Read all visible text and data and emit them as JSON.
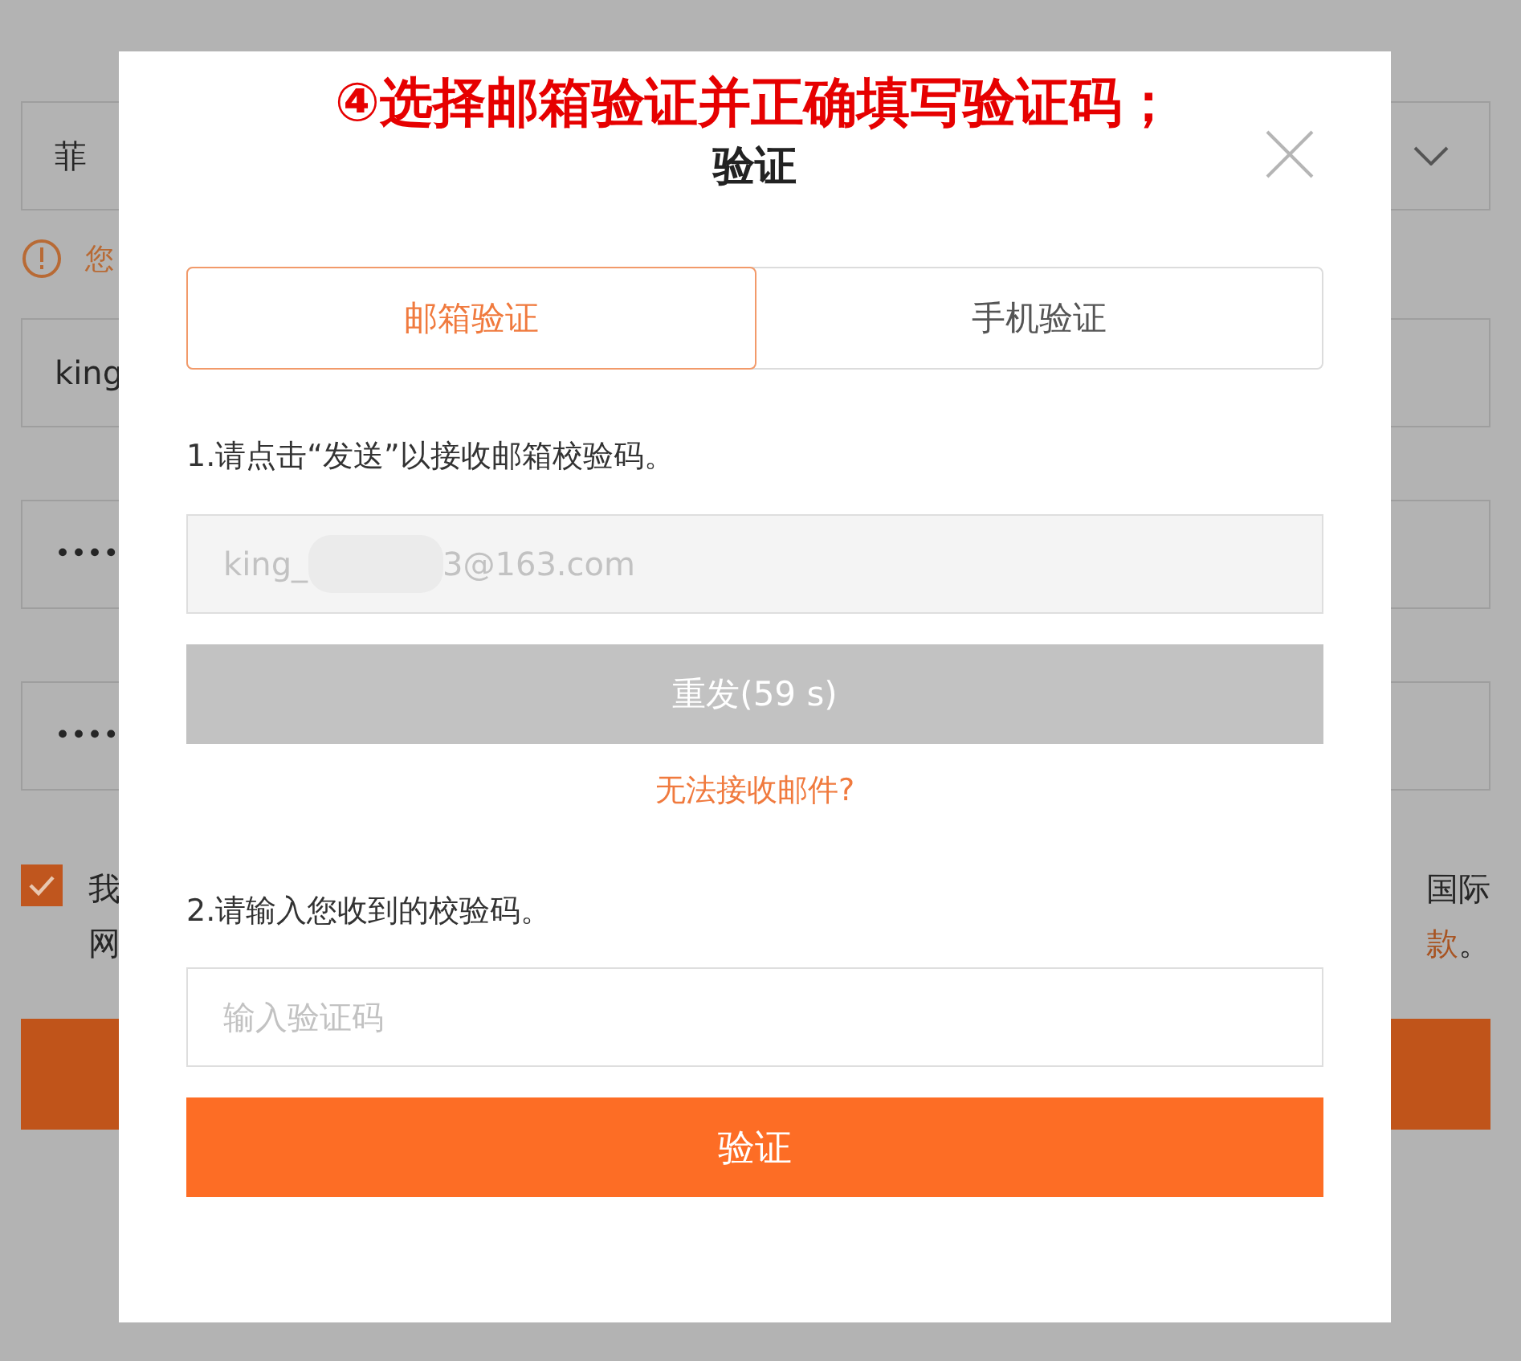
{
  "background": {
    "country_select": {
      "value": "菲"
    },
    "notice": {
      "text": "您"
    },
    "username": {
      "value": "king"
    },
    "password_fields": [
      {
        "value": "••••"
      },
      {
        "value": "••••"
      }
    ],
    "agreement": {
      "checked": true,
      "line_1_start": "我",
      "line_2_start": "网",
      "line_1_end": "国际",
      "line_2_end_link": "款",
      "line_2_end": "。"
    }
  },
  "annotation": "④选择邮箱验证并正确填写验证码；",
  "dialog": {
    "title": "验证",
    "tabs": [
      {
        "label": "邮箱验证",
        "selected": true
      },
      {
        "label": "手机验证",
        "selected": false
      }
    ],
    "step_1": "1.请点击“发送”以接收邮箱校验码。",
    "email_field": {
      "value_start": "king_",
      "value_end": "3@163.com"
    },
    "resend_button": {
      "label": "重发(59 s)",
      "disabled": true
    },
    "help_link": "无法接收邮件?",
    "step_2": "2.请输入您收到的校验码。",
    "code_field": {
      "placeholder": "输入验证码"
    },
    "verify_button": {
      "label": "验证"
    }
  }
}
